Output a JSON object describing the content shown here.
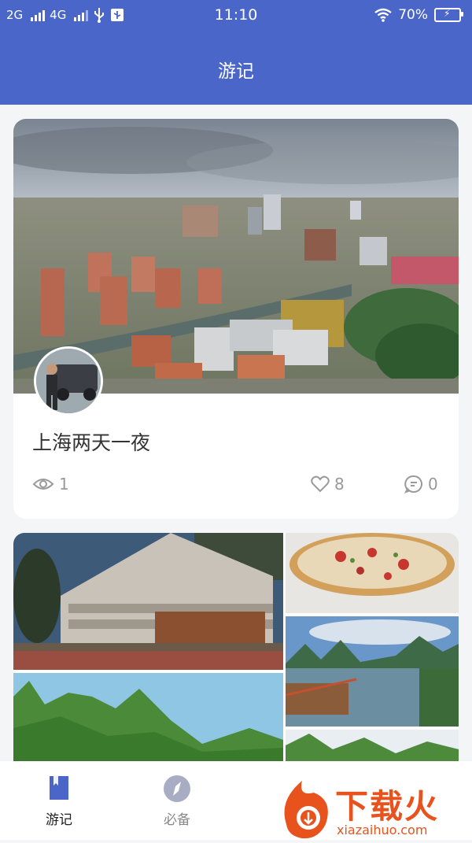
{
  "status_bar": {
    "sim1": "2G",
    "sim2": "4G",
    "time": "11:10",
    "battery": "70%"
  },
  "header": {
    "title": "游记"
  },
  "card": {
    "title": "上海两天一夜",
    "views": "1",
    "likes": "8",
    "comments": "0"
  },
  "tabs": [
    {
      "label": "游记",
      "icon": "bookmark-icon",
      "active": true
    },
    {
      "label": "必备",
      "icon": "compass-icon",
      "active": false
    }
  ],
  "watermark": {
    "brand": "下载火",
    "url": "xiazaihuo.com"
  },
  "colors": {
    "primary": "#4a66c9",
    "text": "#333333",
    "muted": "#999999",
    "watermark": "#e8521c"
  }
}
